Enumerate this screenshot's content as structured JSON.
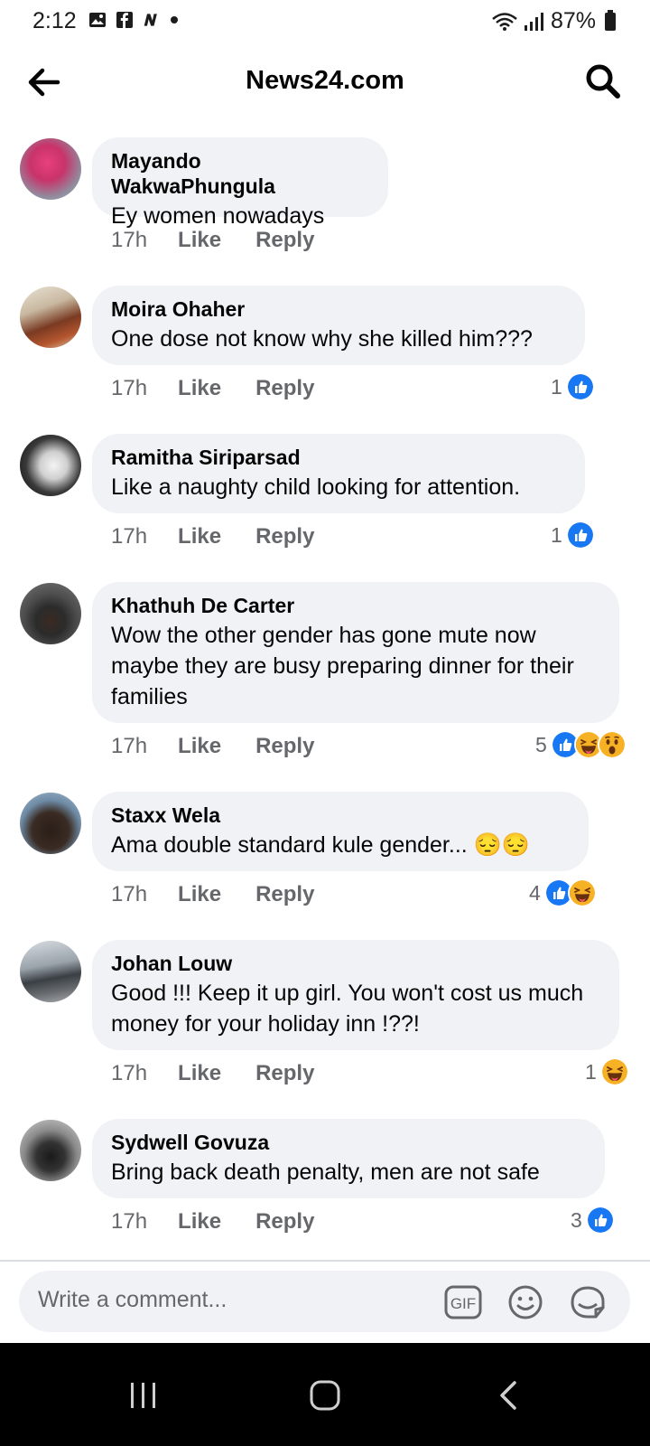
{
  "status_bar": {
    "time": "2:12",
    "battery": "87%"
  },
  "header": {
    "title": "News24.com"
  },
  "comments": [
    {
      "author": "Mayando WakwaPhungula",
      "text": "Ey women nowadays",
      "time": "17h",
      "like": "Like",
      "reply": "Reply",
      "reaction_count": "",
      "reactions": []
    },
    {
      "author": "Moira Ohaher",
      "text": "One dose not know why she killed him???",
      "time": "17h",
      "like": "Like",
      "reply": "Reply",
      "reaction_count": "1",
      "reactions": [
        "like-icon"
      ]
    },
    {
      "author": "Ramitha Siriparsad",
      "text": "Like a naughty child looking for attention.",
      "time": "17h",
      "like": "Like",
      "reply": "Reply",
      "reaction_count": "1",
      "reactions": [
        "like-icon"
      ]
    },
    {
      "author": "Khathuh De Carter",
      "text": "Wow the other gender has gone mute now maybe they are busy preparing dinner for their families",
      "time": "17h",
      "like": "Like",
      "reply": "Reply",
      "reaction_count": "5",
      "reactions": [
        "like-icon",
        "haha-icon",
        "wow-icon"
      ]
    },
    {
      "author": "Staxx Wela",
      "text": "Ama double standard kule gender... 😔😔",
      "time": "17h",
      "like": "Like",
      "reply": "Reply",
      "reaction_count": "4",
      "reactions": [
        "like-icon",
        "haha-icon"
      ]
    },
    {
      "author": "Johan Louw",
      "text": "Good !!! Keep it up girl. You won't cost us much money for your holiday inn !??!",
      "time": "17h",
      "like": "Like",
      "reply": "Reply",
      "reaction_count": "1",
      "reactions": [
        "haha-icon"
      ]
    },
    {
      "author": "Sydwell Govuza",
      "text": "Bring back death penalty, men are not safe",
      "time": "17h",
      "like": "Like",
      "reply": "Reply",
      "reaction_count": "3",
      "reactions": [
        "like-icon"
      ]
    }
  ],
  "composer": {
    "placeholder": "Write a comment..."
  },
  "colors": {
    "accent": "#1877f2",
    "bubble": "#f0f2f5",
    "meta": "#65676b",
    "haha": "#f7b125"
  }
}
